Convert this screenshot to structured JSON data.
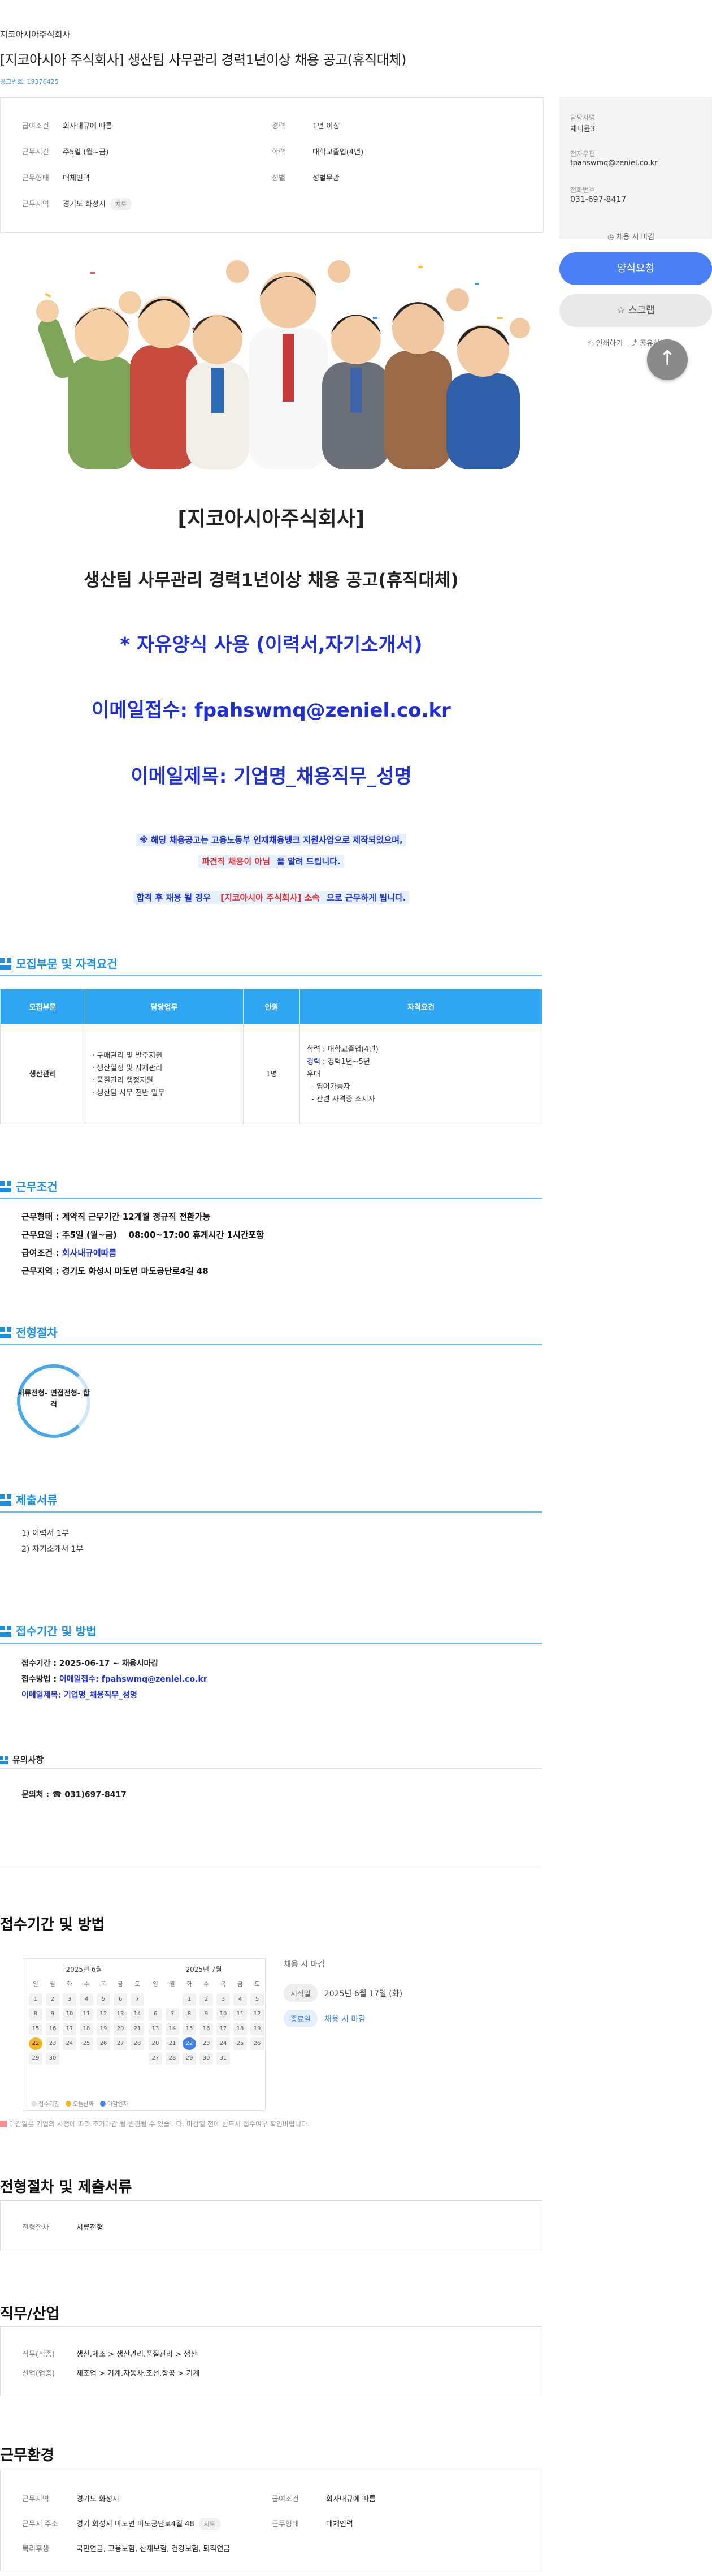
{
  "header": {
    "company": "지코아시아주식회사",
    "title": "[지코아시아 주식회사] 생산팀 사무관리 경력1년이상 채용 공고(휴직대체)",
    "job_no": "공고번호: 19376425"
  },
  "summary": {
    "salary": {
      "k": "급여조건",
      "v": "회사내규에 따름"
    },
    "hours": {
      "k": "근무시간",
      "v": "주5일 (월~금)"
    },
    "type": {
      "k": "근무형태",
      "v": "대체인력"
    },
    "area": {
      "k": "근무지역",
      "v": "경기도 화성시",
      "tag": "지도"
    },
    "career": {
      "k": "경력",
      "v": "1년 이상"
    },
    "edu": {
      "k": "학력",
      "v": "대학교졸업(4년)"
    },
    "gender": {
      "k": "성별",
      "v": "성별무관"
    }
  },
  "contact": {
    "manager_k": "담당자명",
    "manager_v": "재니뮴3",
    "email_k": "전자우편",
    "email_v": "fpahswmq@zeniel.co.kr",
    "phone_k": "전화번호",
    "phone_v": "031-697-8417"
  },
  "actions": {
    "deadline_mini": "채용 시 마감",
    "apply": "양식요청",
    "scrap": "☆ 스크랩",
    "print": "인쇄하기",
    "share": "공유하기"
  },
  "poster": {
    "company": "[지코아시아주식회사]",
    "title": "생산팀 사무관리 경력1년이상 채용 공고(휴직대체)",
    "free_form": "* 자유양식 사용 (이력서,자기소개서)",
    "email_recv": "이메일접수: fpahswmq@zeniel.co.kr",
    "email_subject": "이메일제목: 기업명_채용직무_성명",
    "notice1": "※ 해당 채용공고는 고용노동부 인재채용뱅크 지원사업으로 제작되었으며,",
    "notice2a": "파견직 채용이 아님",
    "notice2b": "을 알려 드립니다.",
    "notice3a": "합격 후 채용 될 경우 ",
    "notice3b": "[지코아시아 주식회사] 소속",
    "notice3c": "으로 근무하게 됩니다."
  },
  "sections": {
    "recruit": "모집부문 및 자격요건",
    "work": "근무조건",
    "process": "전형절차",
    "docs": "제출서류",
    "receipt": "접수기간 및 방법",
    "contact": "유의사항"
  },
  "req_table": {
    "headers": [
      "모집부문",
      "담당업무",
      "인원",
      "자격요건"
    ],
    "part": "생산관리",
    "duties": [
      "· 구매관리 및 발주지원",
      "· 생산일정 및 자재관리",
      "· 품질관리 행정지원",
      "· 생산팀 사무 전반 업무"
    ],
    "count": "1명",
    "qual_edu": "학력 : 대학교졸업(4년)",
    "qual_career_k": "경력",
    "qual_career_v": " : 경력1년~5년",
    "qual_pref": "우대",
    "qual_pref_items": [
      "- 영어가능자",
      "- 관련 자격증 소지자"
    ]
  },
  "work": {
    "l1": "근무형태 : 계약직 근무기간 12개월 정규직 전환가능",
    "l2": "근무요일 : 주5일 (월~금)    08:00~17:00 휴게시간 1시간포함",
    "l3k": "급여조건 : ",
    "l3v": "회사내규에따름",
    "l4": "근무지역 : 경기도 화성시 마도면 마도공단로4길 48"
  },
  "process": {
    "step": "서류전형- 면접전형- 합격"
  },
  "docs": {
    "d1": "1) 이력서 1부",
    "d2": "2) 자기소개서 1부"
  },
  "receipt": {
    "period": "접수기간 : 2025-06-17 ~ 채용시마감",
    "method_k": "접수방법 : ",
    "method_v": "이메일접수: fpahswmq@zeniel.co.kr",
    "subject": "이메일제목: 기업명_채용직무_성명"
  },
  "inquiry": {
    "text": "문의처 : ☎ 031)697-8417"
  },
  "apply_section": {
    "title": "접수기간 및 방법",
    "cal1_month": "2025년 6월",
    "cal2_month": "2025년 7월",
    "weekdays": [
      "일",
      "월",
      "화",
      "수",
      "목",
      "금",
      "토"
    ],
    "legend_today": "접수기간",
    "legend_start": "오늘날짜",
    "legend_end": "마감일자",
    "dl_title": "채용 시 마감",
    "start_pill": "시작일",
    "start_date": "2025년 6월 17일 (화)",
    "end_pill": "종료일",
    "end_text": "채용 시 마감",
    "note": "마감일은 기업의 사정에 따라 조기마감 될 변경될 수 있습니다. 마감일 전에 반드시 접수여부 확인바랍니다."
  },
  "proc_docs": {
    "title": "전형절차 및 제출서류",
    "k": "전형절차",
    "v": "서류전형"
  },
  "industry": {
    "title": "직무/산업",
    "job_k": "직무(직종)",
    "job_v": "생산.제조 > 생산관리.품질관리 > 생산",
    "ind_k": "산업(업종)",
    "ind_v": "제조업 > 기계.자동차.조선.항공 > 기계"
  },
  "env": {
    "title": "근무환경",
    "area_k": "근무지역",
    "area_v": "경기도 화성시",
    "addr_k": "근무지 주소",
    "addr_v": "경기 화성시 마도면 마도공단로4길 48",
    "addr_tag": "지도",
    "welfare_k": "복리후생",
    "welfare_v": "국민연금, 고용보험, 산재보험, 건강보험, 퇴직연금",
    "sal_k": "급여조건",
    "sal_v": "회사내규에 따름",
    "type_k": "근무형태",
    "type_v": "대체인력"
  }
}
